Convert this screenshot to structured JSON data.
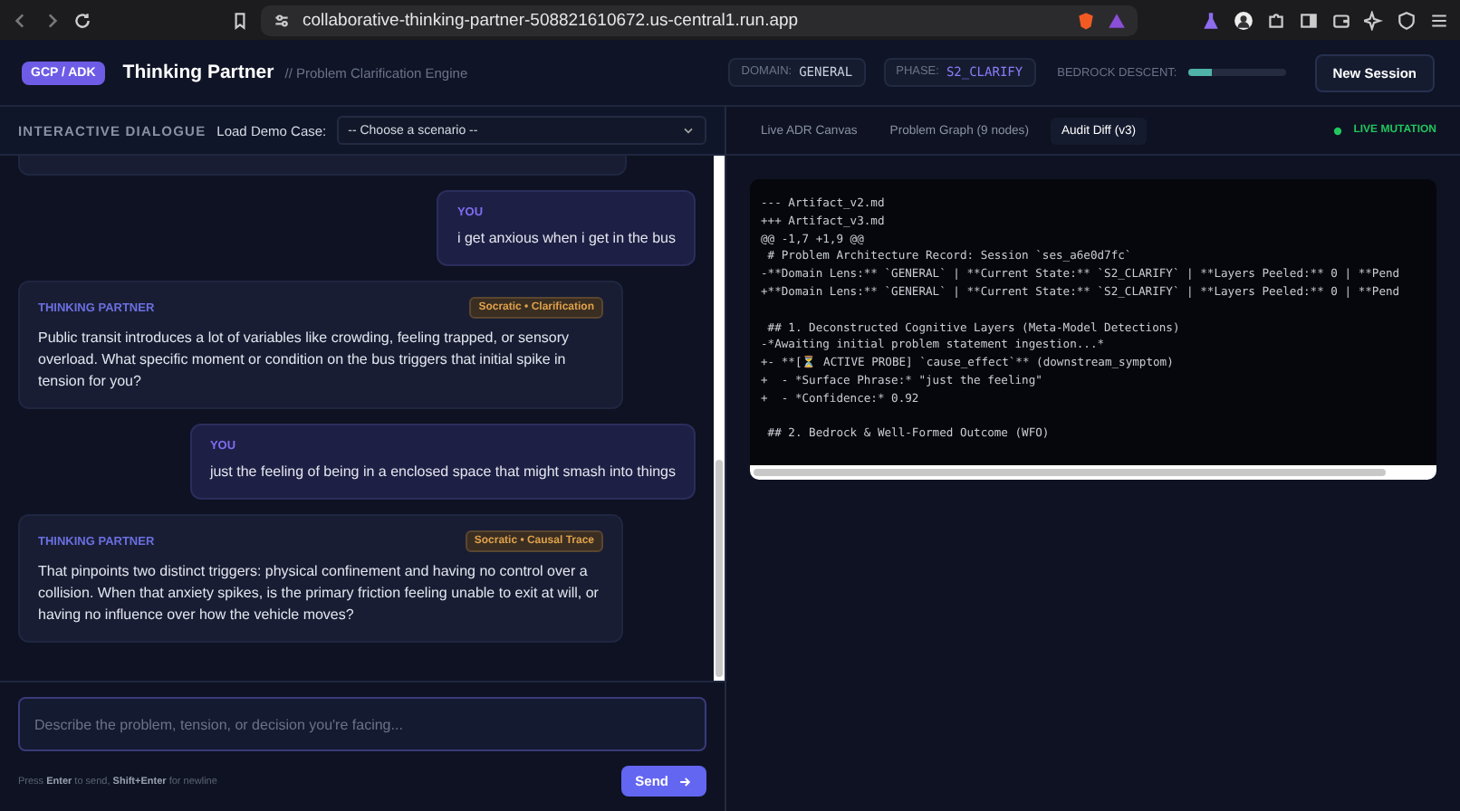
{
  "browser": {
    "url": "collaborative-thinking-partner-508821610672.us-central1.run.app"
  },
  "header": {
    "badge": "GCP / ADK",
    "title": "Thinking Partner",
    "subtitle": "// Problem Clarification Engine",
    "domain_label": "DOMAIN:",
    "domain": "GENERAL",
    "phase_label": "PHASE:",
    "phase": "S2_CLARIFY",
    "bedrock_label": "BEDROCK DESCENT:",
    "bedrock": {
      "level": 0.25
    },
    "new_session": "New Session"
  },
  "dialogue": {
    "heading": "INTERACTIVE DIALOGUE",
    "demo_label": "Load Demo Case:",
    "demo_select": "-- Choose a scenario --",
    "messages": [
      {
        "kind": "user",
        "author": "YOU",
        "text": "i get anxious when i get in the bus"
      },
      {
        "kind": "partner",
        "author": "THINKING PARTNER",
        "tag": "Socratic • Clarification",
        "text": "Public transit introduces a lot of variables like crowding, feeling trapped, or sensory overload. What specific moment or condition on the bus triggers that initial spike in tension for you?"
      },
      {
        "kind": "user",
        "author": "YOU",
        "text": "just the feeling of being in a enclosed space that might smash into things"
      },
      {
        "kind": "partner",
        "author": "THINKING PARTNER",
        "tag": "Socratic • Causal Trace",
        "text": "That pinpoints two distinct triggers: physical confinement and having no control over a collision. When that anxiety spikes, is the primary friction feeling unable to exit at will, or having no influence over how the vehicle moves?"
      }
    ],
    "input_placeholder": "Describe the problem, tension, or decision you're facing...",
    "hint": "Press **Enter** to send, **Shift+Enter** for newline",
    "send": "Send"
  },
  "tabs": [
    {
      "label": "Live ADR Canvas",
      "selected": false
    },
    {
      "label": "Problem Graph (9 nodes)",
      "selected": false
    },
    {
      "label": "Audit Diff (v3)",
      "selected": true
    }
  ],
  "live_status": "LIVE MUTATION",
  "diff_blocks": [
    [
      "--- Artifact_v2.md",
      "+++ Artifact_v3.md",
      "@@ -1,7 +1,9 @@",
      " # Problem Architecture Record: Session `ses_a6e0d7fc`",
      "-**Domain Lens:** `GENERAL` | **Current State:** `S2_CLARIFY` | **Layers Peeled:** 0 | **Pend",
      "+**Domain Lens:** `GENERAL` | **Current State:** `S2_CLARIFY` | **Layers Peeled:** 0 | **Pend"
    ],
    [
      " ## 1. Deconstructed Cognitive Layers (Meta-Model Detections)",
      "-*Awaiting initial problem statement ingestion...*",
      "+- **[⏳ ACTIVE PROBE] `cause_effect`** (downstream_symptom)",
      "+  - *Surface Phrase:* \"just the feeling\"",
      "+  - *Confidence:* 0.92"
    ],
    [
      " ## 2. Bedrock & Well-Formed Outcome (WFO)"
    ]
  ]
}
